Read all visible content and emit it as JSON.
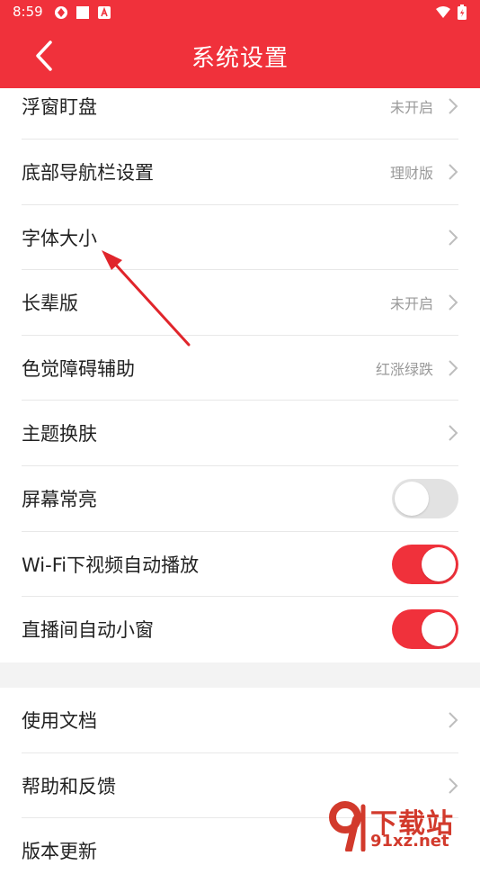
{
  "status_bar": {
    "time": "8:59"
  },
  "header": {
    "title": "系统设置"
  },
  "settings_group1": [
    {
      "label": "浮窗盯盘",
      "value": "未开启"
    },
    {
      "label": "底部导航栏设置",
      "value": "理财版"
    },
    {
      "label": "字体大小",
      "value": ""
    },
    {
      "label": "长辈版",
      "value": "未开启"
    },
    {
      "label": "色觉障碍辅助",
      "value": "红涨绿跌"
    },
    {
      "label": "主题换肤",
      "value": ""
    },
    {
      "label": "屏幕常亮",
      "toggle": false
    },
    {
      "label": "Wi-Fi下视频自动播放",
      "toggle": true
    },
    {
      "label": "直播间自动小窗",
      "toggle": true
    }
  ],
  "settings_group2": [
    {
      "label": "使用文档"
    },
    {
      "label": "帮助和反馈"
    },
    {
      "label": "版本更新"
    }
  ],
  "watermark": {
    "brand": "下载站",
    "url": "91xz.net"
  },
  "colors": {
    "accent": "#f0313b",
    "toggle_off": "#e2e2e2"
  }
}
